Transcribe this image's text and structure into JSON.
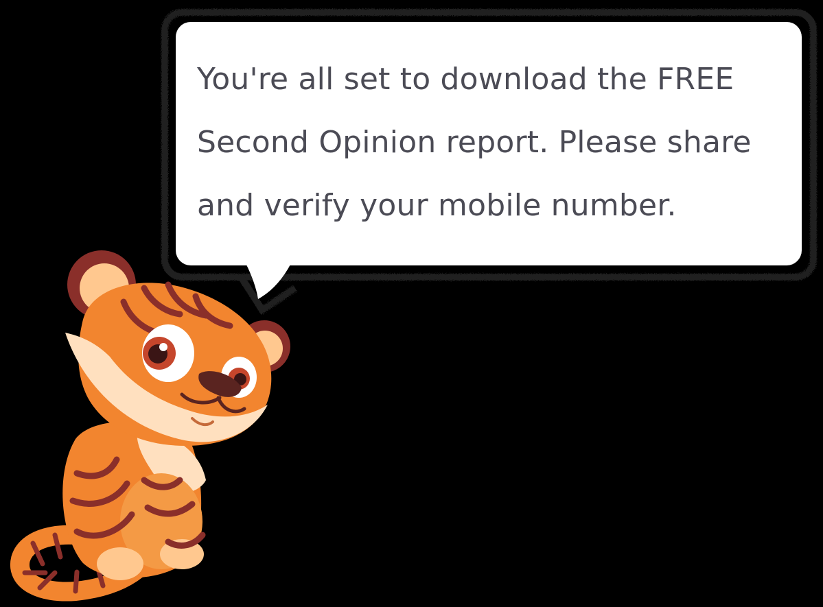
{
  "bubble": {
    "lines": [
      "You're all set to download the FREE",
      "Second Opinion report. Please share",
      "and verify your mobile number."
    ]
  },
  "mascot": {
    "icon": "tiger-mascot-icon"
  },
  "colors": {
    "background": "#000000",
    "bubble_fill": "#ffffff",
    "bubble_text": "#4b4b55",
    "tiger_orange": "#f2852f",
    "tiger_light": "#ffc88f",
    "tiger_cream": "#ffe0bf",
    "tiger_stripe": "#8a2f2a"
  }
}
